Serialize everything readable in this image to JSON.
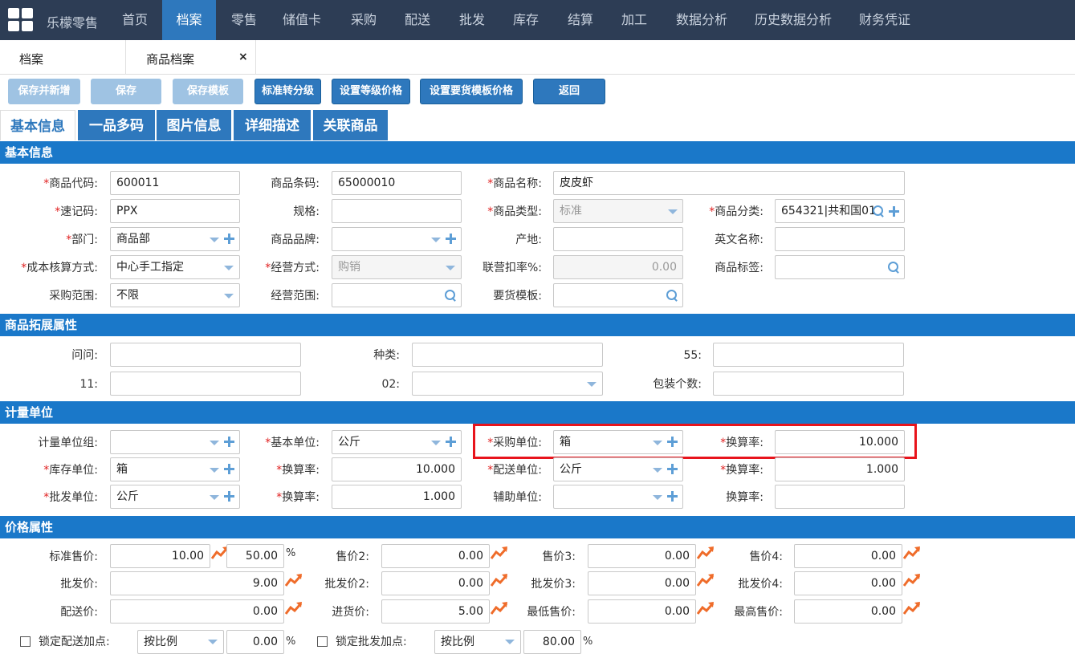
{
  "topnav": {
    "brand": "乐檬零售",
    "items": [
      "首页",
      "档案",
      "零售",
      "储值卡",
      "采购",
      "配送",
      "批发",
      "库存",
      "结算",
      "加工",
      "数据分析",
      "历史数据分析",
      "财务凭证"
    ],
    "active_index": 1
  },
  "page_tabs": {
    "tab1": "档案",
    "tab2": "商品档案",
    "close": "×"
  },
  "toolbar": {
    "save_new": "保存并新增",
    "save": "保存",
    "save_template": "保存模板",
    "std_to_grade": "标准转分级",
    "set_grade_price": "设置等级价格",
    "set_order_template_price": "设置要货模板价格",
    "back": "返回"
  },
  "sub_tabs": [
    "基本信息",
    "一品多码",
    "图片信息",
    "详细描述",
    "关联商品"
  ],
  "sections": {
    "basic": "基本信息",
    "ext": "商品拓展属性",
    "unit": "计量单位",
    "price": "价格属性"
  },
  "basic": {
    "code_label": "商品代码:",
    "code": "600011",
    "barcode_label": "商品条码:",
    "barcode": "65000010",
    "name_label": "商品名称:",
    "name": "皮皮虾",
    "mnemonic_label": "速记码:",
    "mnemonic": "PPX",
    "spec_label": "规格:",
    "spec": "",
    "type_label": "商品类型:",
    "type": "标准",
    "category_label": "商品分类:",
    "category": "654321|共和国01",
    "dept_label": "部门:",
    "dept": "商品部",
    "brand_label": "商品品牌:",
    "brand": "",
    "origin_label": "产地:",
    "origin": "",
    "en_name_label": "英文名称:",
    "en_name": "",
    "cost_label": "成本核算方式:",
    "cost": "中心手工指定",
    "biz_mode_label": "经营方式:",
    "biz_mode": "购销",
    "joint_rate_label": "联营扣率%:",
    "joint_rate": "0.00",
    "tag_label": "商品标签:",
    "tag": "",
    "purchase_scope_label": "采购范围:",
    "purchase_scope": "不限",
    "biz_scope_label": "经营范围:",
    "biz_scope": "",
    "order_template_label": "要货模板:",
    "order_template": ""
  },
  "ext": {
    "wen_label": "问问:",
    "wen": "",
    "kind_label": "种类:",
    "kind": "",
    "f55_label": "55:",
    "f55": "",
    "f11_label": "11:",
    "f11": "",
    "f02_label": "02:",
    "f02": "",
    "pack_label": "包装个数:",
    "pack": ""
  },
  "unit": {
    "group_label": "计量单位组:",
    "group": "",
    "base_label": "基本单位:",
    "base": "公斤",
    "purchase_label": "采购单位:",
    "purchase": "箱",
    "purchase_rate_label": "换算率:",
    "purchase_rate": "10.000",
    "stock_label": "库存单位:",
    "stock": "箱",
    "stock_rate_label": "换算率:",
    "stock_rate": "10.000",
    "delivery_label": "配送单位:",
    "delivery": "公斤",
    "delivery_rate_label": "换算率:",
    "delivery_rate": "1.000",
    "wholesale_label": "批发单位:",
    "wholesale": "公斤",
    "wholesale_rate_label": "换算率:",
    "wholesale_rate": "1.000",
    "aux_label": "辅助单位:",
    "aux": "",
    "aux_rate_label": "换算率:",
    "aux_rate": ""
  },
  "price": {
    "std_label": "标准售价:",
    "std": "10.00",
    "std_pct": "50.00",
    "pct_sign": "%",
    "p2_label": "售价2:",
    "p2": "0.00",
    "p3_label": "售价3:",
    "p3": "0.00",
    "p4_label": "售价4:",
    "p4": "0.00",
    "w_label": "批发价:",
    "w": "9.00",
    "w2_label": "批发价2:",
    "w2": "0.00",
    "w3_label": "批发价3:",
    "w3": "0.00",
    "w4_label": "批发价4:",
    "w4": "0.00",
    "d_label": "配送价:",
    "d": "0.00",
    "in_label": "进货价:",
    "in": "5.00",
    "min_label": "最低售价:",
    "min": "0.00",
    "max_label": "最高售价:",
    "max": "0.00",
    "lock_d_label": "锁定配送加点:",
    "lock_d_mode": "按比例",
    "lock_d_val": "0.00",
    "lock_w_label": "锁定批发加点:",
    "lock_w_mode": "按比例",
    "lock_w_val": "80.00"
  },
  "colors": {
    "nav_bg": "#2d3d55",
    "accent": "#2e78bd",
    "section": "#1a78c9",
    "highlight": "#e8141c",
    "trend": "#ef6c2a"
  }
}
